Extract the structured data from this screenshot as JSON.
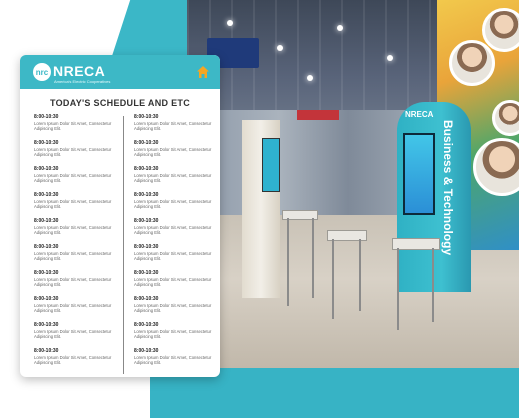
{
  "app": {
    "logo_text": "NRECA",
    "logo_mark": "nrc",
    "logo_tagline": "America's Electric Cooperatives"
  },
  "schedule": {
    "title": "TODAY'S SCHEDULE AND ETC",
    "left_column": [
      {
        "time": "8:00-10:30",
        "desc": "Lorem Ipsum Dolor Sit Amet, Consectetur Adipiscing Elit."
      },
      {
        "time": "8:00-10:30",
        "desc": "Lorem Ipsum Dolor Sit Amet, Consectetur Adipiscing Elit."
      },
      {
        "time": "8:00-10:30",
        "desc": "Lorem Ipsum Dolor Sit Amet, Consectetur Adipiscing Elit."
      },
      {
        "time": "8:00-10:30",
        "desc": "Lorem Ipsum Dolor Sit Amet, Consectetur Adipiscing Elit."
      },
      {
        "time": "8:00-10:30",
        "desc": "Lorem Ipsum Dolor Sit Amet, Consectetur Adipiscing Elit."
      },
      {
        "time": "8:00-10:30",
        "desc": "Lorem Ipsum Dolor Sit Amet, Consectetur Adipiscing Elit."
      },
      {
        "time": "8:00-10:30",
        "desc": "Lorem Ipsum Dolor Sit Amet, Consectetur Adipiscing Elit."
      },
      {
        "time": "8:00-10:30",
        "desc": "Lorem Ipsum Dolor Sit Amet, Consectetur Adipiscing Elit."
      },
      {
        "time": "8:00-10:30",
        "desc": "Lorem Ipsum Dolor Sit Amet, Consectetur Adipiscing Elit."
      },
      {
        "time": "8:00-10:30",
        "desc": "Lorem Ipsum Dolor Sit Amet, Consectetur Adipiscing Elit."
      }
    ],
    "right_column": [
      {
        "time": "8:00-10:30",
        "desc": "Lorem Ipsum Dolor Sit Amet, Consectetur Adipiscing Elit."
      },
      {
        "time": "8:00-10:30",
        "desc": "Lorem Ipsum Dolor Sit Amet, Consectetur Adipiscing Elit."
      },
      {
        "time": "8:00-10:30",
        "desc": "Lorem Ipsum Dolor Sit Amet, Consectetur Adipiscing Elit."
      },
      {
        "time": "8:00-10:30",
        "desc": "Lorem Ipsum Dolor Sit Amet, Consectetur Adipiscing Elit."
      },
      {
        "time": "8:00-10:30",
        "desc": "Lorem Ipsum Dolor Sit Amet, Consectetur Adipiscing Elit."
      },
      {
        "time": "8:00-10:30",
        "desc": "Lorem Ipsum Dolor Sit Amet, Consectetur Adipiscing Elit."
      },
      {
        "time": "8:00-10:30",
        "desc": "Lorem Ipsum Dolor Sit Amet, Consectetur Adipiscing Elit."
      },
      {
        "time": "8:00-10:30",
        "desc": "Lorem Ipsum Dolor Sit Amet, Consectetur Adipiscing Elit."
      },
      {
        "time": "8:00-10:30",
        "desc": "Lorem Ipsum Dolor Sit Amet, Consectetur Adipiscing Elit."
      },
      {
        "time": "8:00-10:30",
        "desc": "Lorem Ipsum Dolor Sit Amet, Consectetur Adipiscing Elit."
      }
    ]
  },
  "photo": {
    "tower_text": "Business & Technology",
    "tower_logo": "NRECA"
  },
  "icons": {
    "home": "home-icon",
    "logo": "nreca-logo-icon"
  },
  "colors": {
    "accent": "#3db8c6",
    "home_icon": "#f5a623",
    "text_dark": "#333333"
  }
}
